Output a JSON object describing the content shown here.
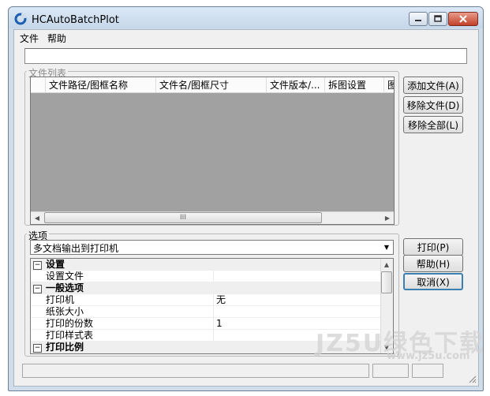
{
  "window": {
    "title": "HCAutoBatchPlot"
  },
  "menu": {
    "file": "文件",
    "help": "帮助"
  },
  "path_bar": {
    "value": ""
  },
  "file_group": {
    "title": "文件列表",
    "columns": [
      "文件路径/图框名称",
      "文件名/图框尺寸",
      "文件版本/...",
      "拆图设置",
      "图"
    ],
    "scroll_grip": "III"
  },
  "file_buttons": {
    "add": "添加文件(A)",
    "remove": "移除文件(D)",
    "remove_all": "移除全部(L)"
  },
  "options_group": {
    "title": "选项",
    "output_mode": "多文档输出到打印机",
    "properties": [
      {
        "type": "category",
        "toggle": "⊟",
        "name": "设置",
        "value": ""
      },
      {
        "type": "item",
        "name": "设置文件",
        "value": ""
      },
      {
        "type": "category",
        "toggle": "⊟",
        "name": "一般选项",
        "value": ""
      },
      {
        "type": "item",
        "name": "打印机",
        "value": "无"
      },
      {
        "type": "item",
        "name": "纸张大小",
        "value": ""
      },
      {
        "type": "item",
        "name": "打印的份数",
        "value": "1"
      },
      {
        "type": "item",
        "name": "打印样式表",
        "value": ""
      },
      {
        "type": "category",
        "toggle": "⊟",
        "name": "打印比例",
        "value": ""
      }
    ]
  },
  "action_buttons": {
    "print": "打印(P)",
    "help": "帮助(H)",
    "cancel": "取消(X)"
  },
  "watermark": {
    "text": "JZ5U绿色下载",
    "url": "www.jz5u.com"
  },
  "colors": {
    "list_background": "#a1a1a1",
    "default_button_border": "#3c7fb1",
    "close_button": "#c2412a"
  }
}
